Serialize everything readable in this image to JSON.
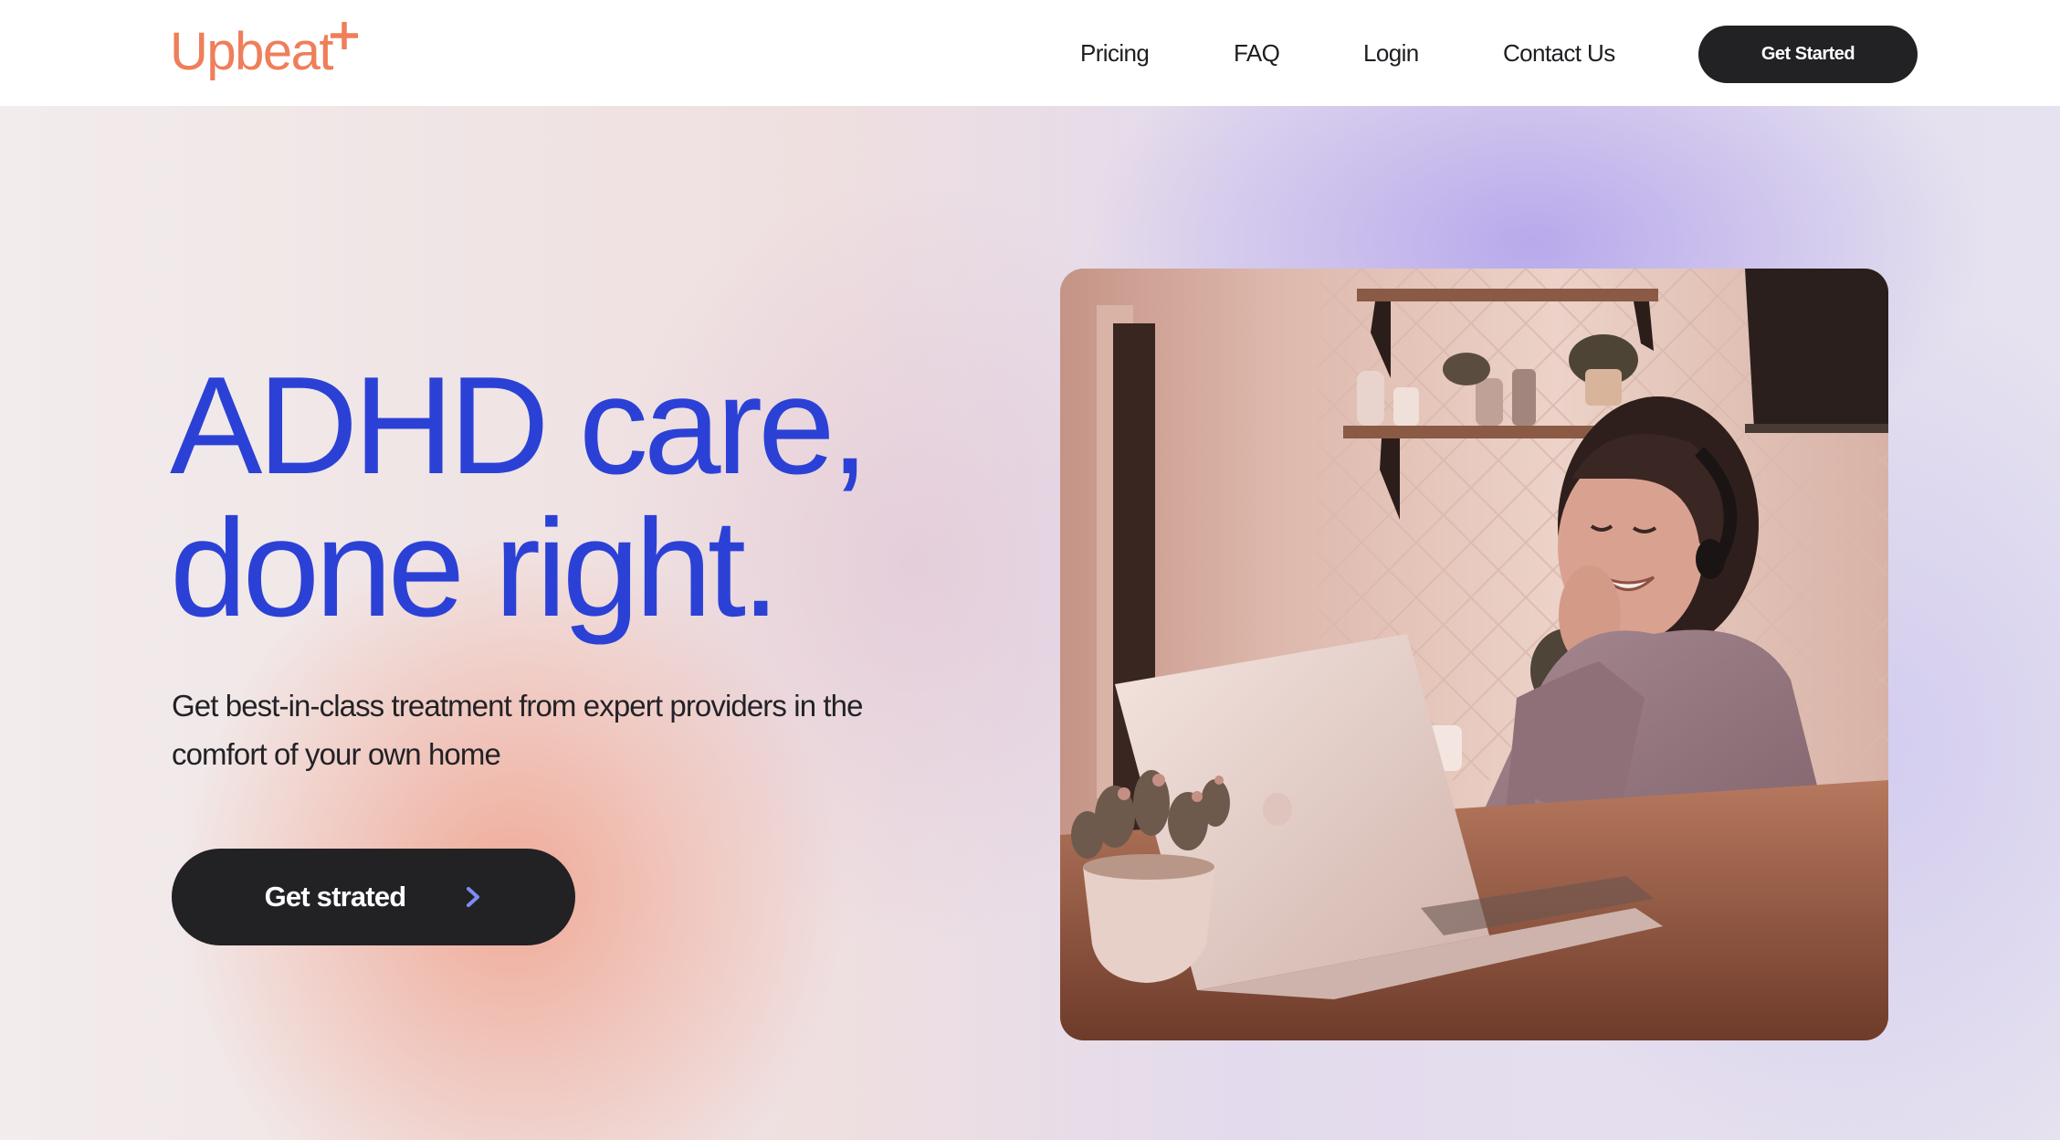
{
  "header": {
    "logo_text": "Upbeat",
    "logo_icon": "sparkle-icon",
    "nav": [
      {
        "label": "Pricing"
      },
      {
        "label": "FAQ"
      },
      {
        "label": "Login"
      },
      {
        "label": "Contact Us"
      }
    ],
    "cta_label": "Get Started"
  },
  "hero": {
    "title_line1": "ADHD care,",
    "title_line2": "done right.",
    "subtitle": "Get best-in-class treatment from expert providers in the comfort of your own home",
    "cta_label": "Get strated",
    "cta_icon": "arrow-right-icon",
    "photo_icon": "woman-at-laptop-photo"
  },
  "colors": {
    "brand": "#ef7e5a",
    "title": "#2b41d6",
    "button": "#222225",
    "text": "#222226"
  }
}
